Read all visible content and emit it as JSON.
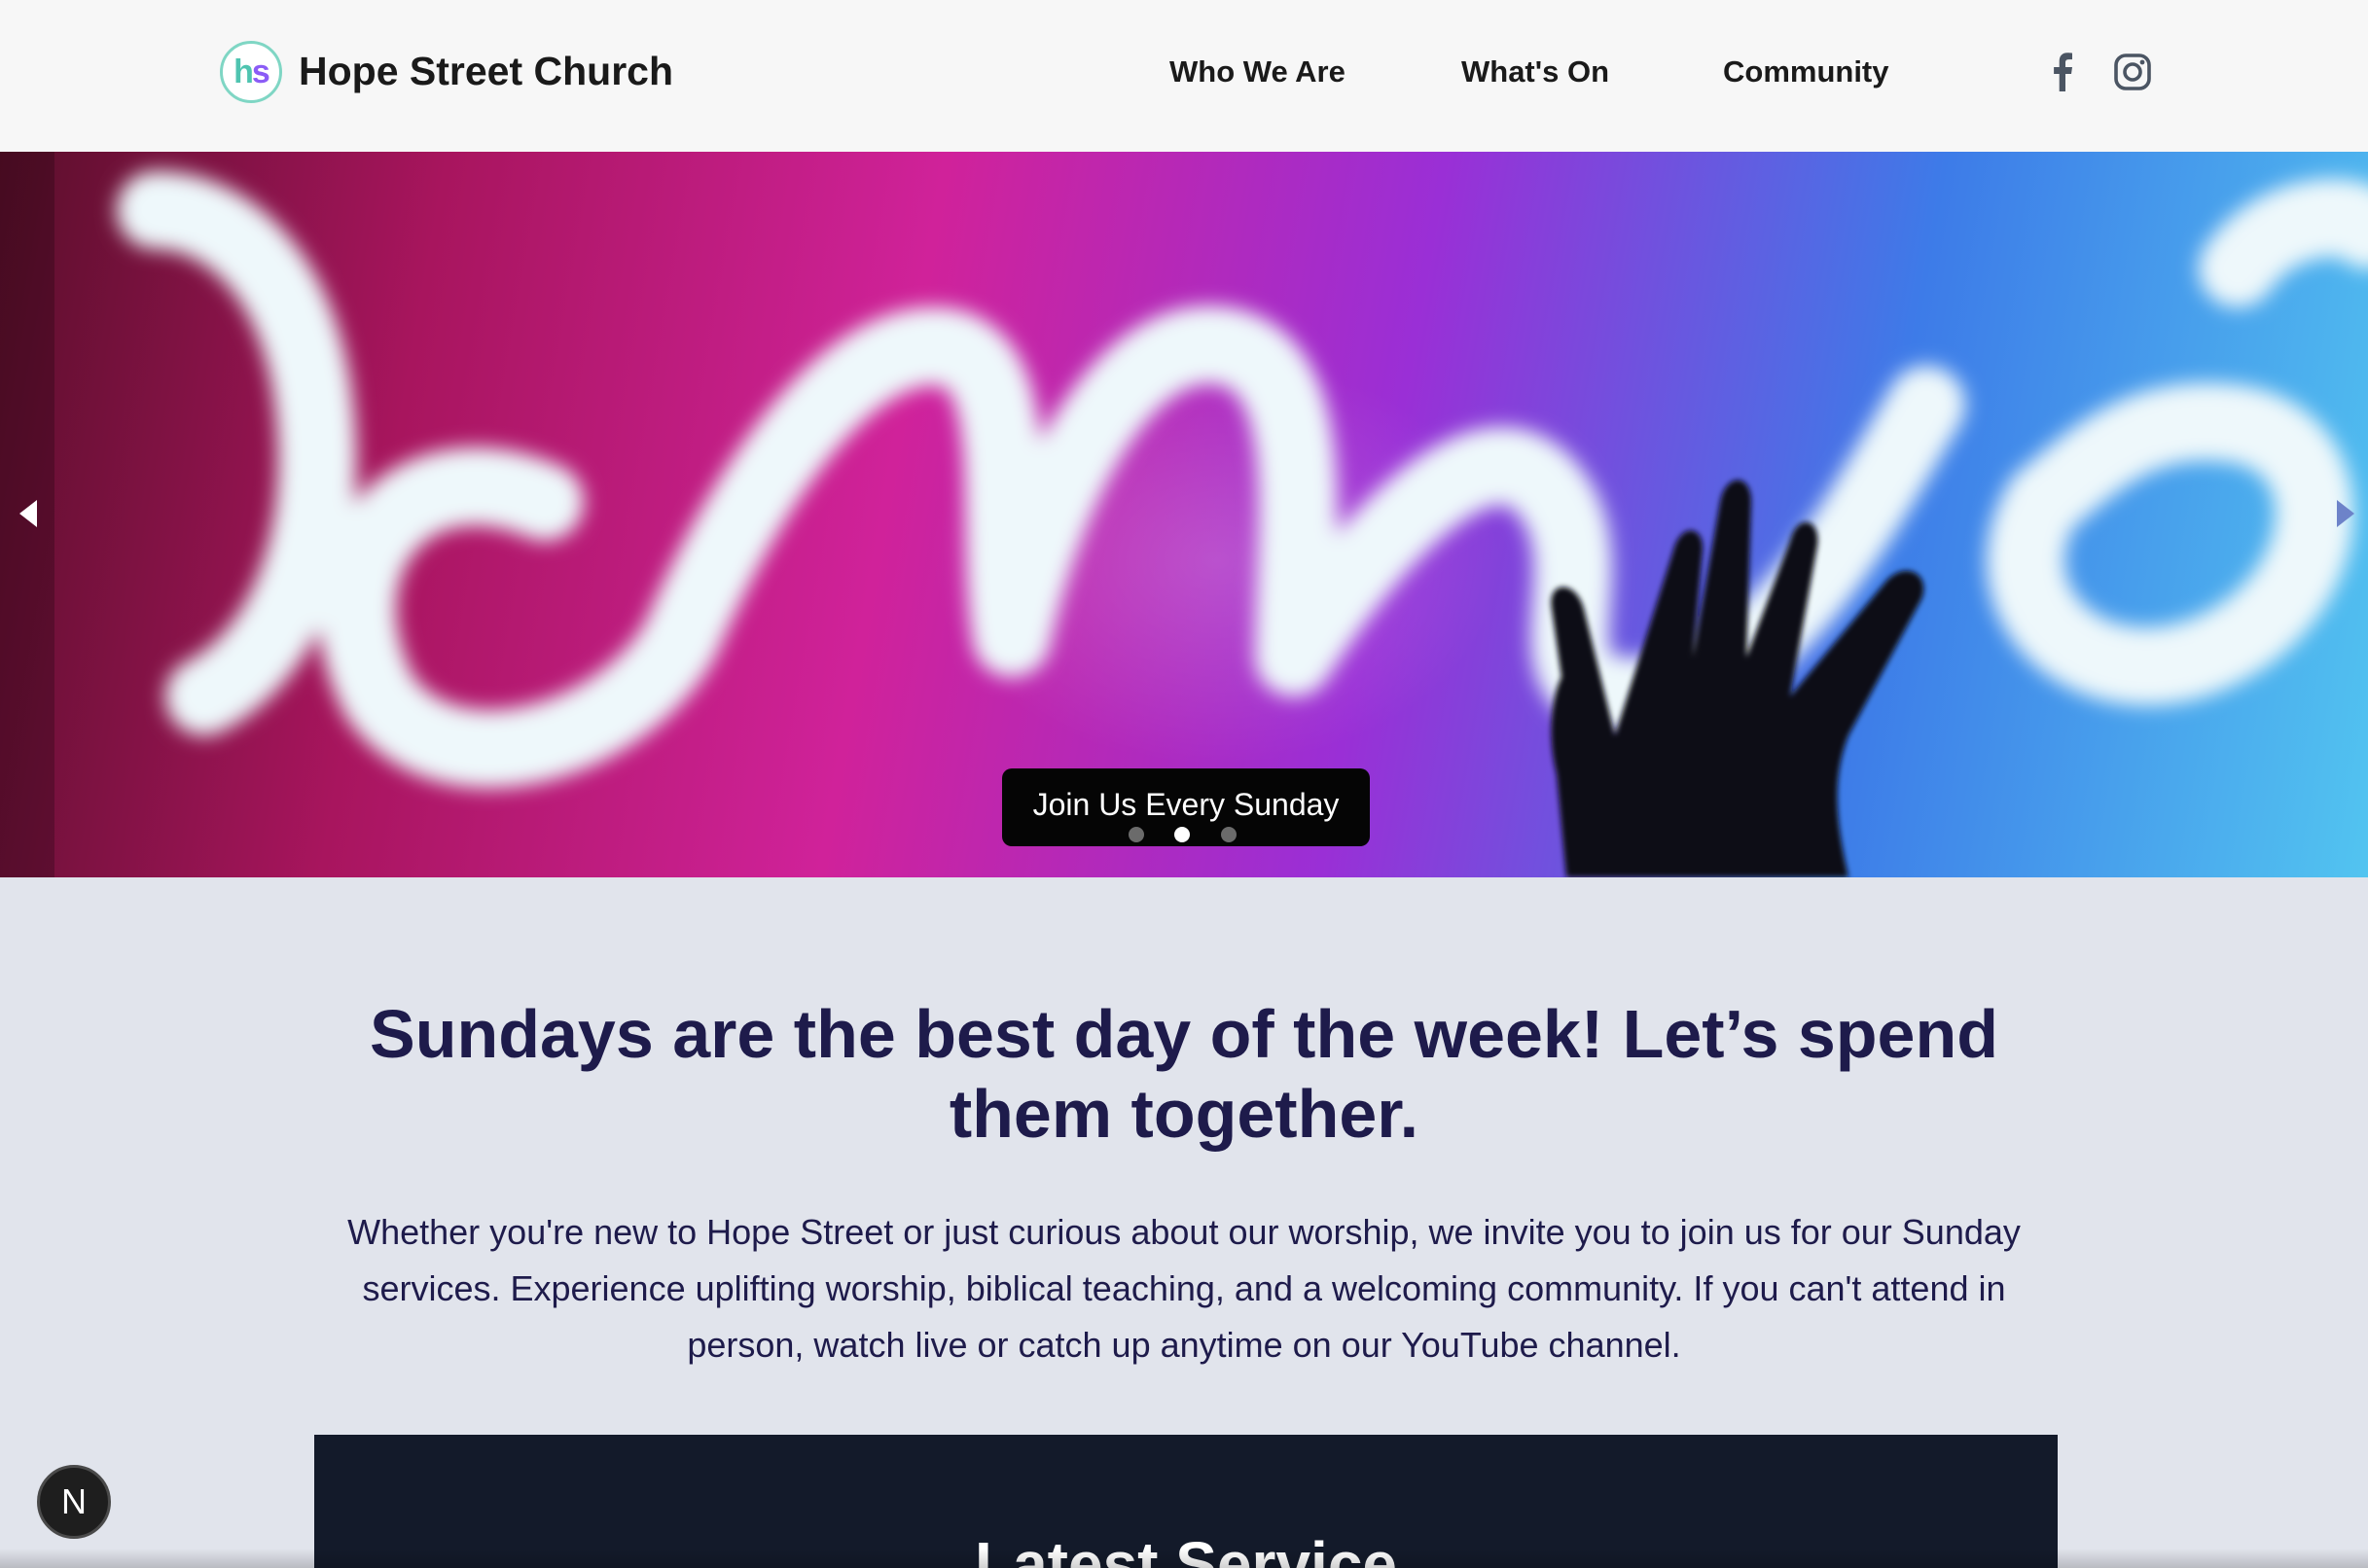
{
  "header": {
    "logo_text_h": "h",
    "logo_text_s": "s",
    "site_title": "Hope Street Church",
    "nav": [
      {
        "label": "Who We Are"
      },
      {
        "label": "What's On"
      },
      {
        "label": "Community"
      }
    ],
    "social": [
      "facebook-icon",
      "instagram-icon"
    ]
  },
  "hero": {
    "caption": "Join Us Every Sunday",
    "slide_count": 3,
    "active_slide": 2,
    "prev_icon": "triangle-left-icon",
    "next_icon": "triangle-right-icon"
  },
  "main": {
    "headline": "Sundays are the best day of the week! Let’s spend them together.",
    "intro": "Whether you're new to Hope Street or just curious about our worship, we invite you to join us for our Sunday services. Experience uplifting worship, biblical teaching, and a welcoming community. If you can't attend in person, watch live or catch up anytime on our YouTube channel.",
    "latest_service_heading": "Latest Service"
  },
  "dev_badge": "N",
  "colors": {
    "headline": "#1e1b4b",
    "page_bg": "#e1e4ec",
    "header_bg": "#f7f7f7",
    "card_bg": "#131a2a",
    "logo_teal": "#4fc4b0",
    "logo_purple": "#8b5cf6"
  }
}
